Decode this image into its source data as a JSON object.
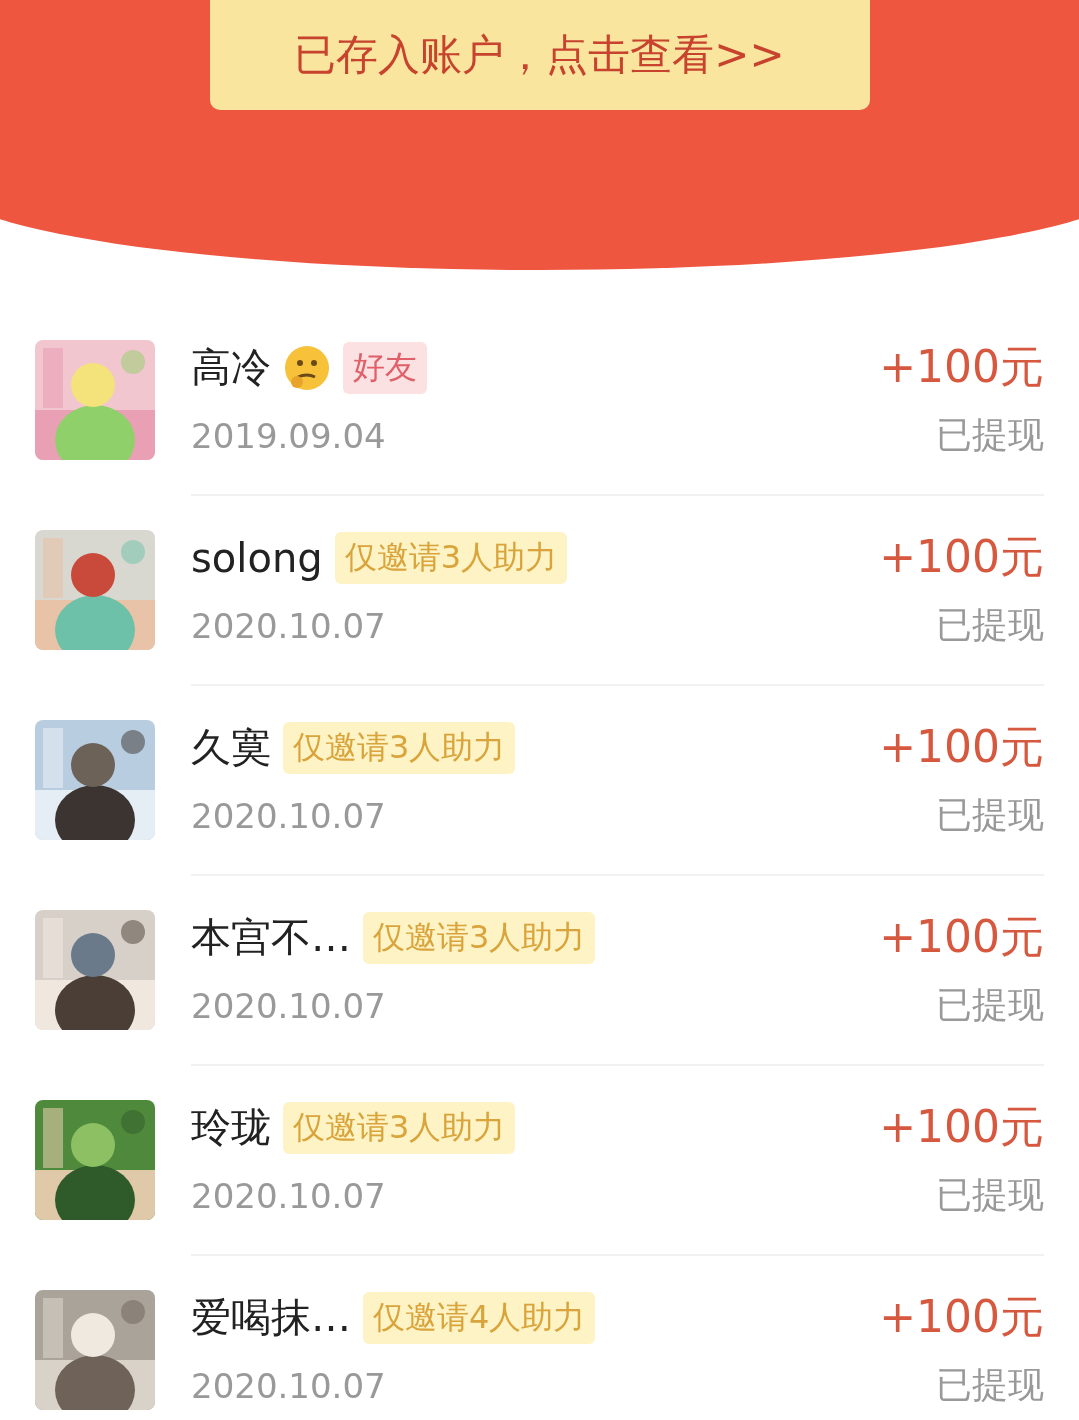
{
  "banner": {
    "button": "已存入账户，点击查看>>"
  },
  "records": [
    {
      "name": "高冷",
      "emoji": true,
      "tag": {
        "kind": "friend",
        "text": "好友"
      },
      "date": "2019.09.04",
      "amount": "+100元",
      "status": "已提现"
    },
    {
      "name": "solong",
      "emoji": false,
      "tag": {
        "kind": "invite",
        "text": "仅邀请3人助力"
      },
      "date": "2020.10.07",
      "amount": "+100元",
      "status": "已提现"
    },
    {
      "name": "久寞",
      "emoji": false,
      "tag": {
        "kind": "invite",
        "text": "仅邀请3人助力"
      },
      "date": "2020.10.07",
      "amount": "+100元",
      "status": "已提现"
    },
    {
      "name": "本宫不…",
      "emoji": false,
      "tag": {
        "kind": "invite",
        "text": "仅邀请3人助力"
      },
      "date": "2020.10.07",
      "amount": "+100元",
      "status": "已提现"
    },
    {
      "name": "玲珑",
      "emoji": false,
      "tag": {
        "kind": "invite",
        "text": "仅邀请3人助力"
      },
      "date": "2020.10.07",
      "amount": "+100元",
      "status": "已提现"
    },
    {
      "name": "爱喝抹…",
      "emoji": false,
      "tag": {
        "kind": "invite",
        "text": "仅邀请4人助力"
      },
      "date": "2020.10.07",
      "amount": "+100元",
      "status": "已提现"
    }
  ]
}
